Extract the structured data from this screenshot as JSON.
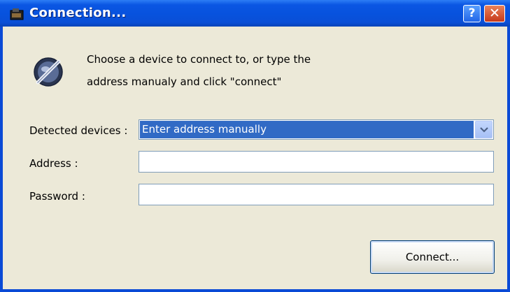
{
  "window": {
    "title": "Connection...",
    "help_label": "?",
    "close_label": "✕"
  },
  "info": {
    "line1": "Choose a device to connect to, or type the",
    "line2": "address manualy and click \"connect\""
  },
  "form": {
    "detected_label": "Detected devices :",
    "detected_value": "Enter address manually",
    "address_label": "Address :",
    "address_value": "",
    "password_label": "Password :",
    "password_value": ""
  },
  "actions": {
    "connect_label": "Connect..."
  },
  "icons": {
    "title": "app-icon",
    "connection": "plug-connection-icon",
    "dropdown": "chevron-down-icon"
  },
  "colors": {
    "titlebar": "#0752dd",
    "dialog_bg": "#ece9d8",
    "selection": "#316ac5"
  }
}
